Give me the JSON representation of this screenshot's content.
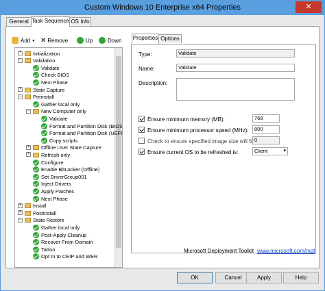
{
  "window": {
    "title": "Custom Windows 10 Enterprise x64 Properties",
    "close": "✕"
  },
  "tabs": [
    "General",
    "Task Sequence",
    "OS Info"
  ],
  "toolbar": {
    "add": "Add",
    "remove": "Remove",
    "up": "Up",
    "down": "Down"
  },
  "tree": [
    {
      "label": "Initialization",
      "icon": "folder",
      "level": 1,
      "exp": "+"
    },
    {
      "label": "Validation",
      "icon": "folder",
      "level": 1,
      "exp": "−"
    },
    {
      "label": "Validate",
      "icon": "check",
      "level": 2
    },
    {
      "label": "Check BIOS",
      "icon": "check",
      "level": 2
    },
    {
      "label": "Next Phase",
      "icon": "check",
      "level": 2
    },
    {
      "label": "State Capture",
      "icon": "folder",
      "level": 1,
      "exp": "+"
    },
    {
      "label": "Preinstall",
      "icon": "folder",
      "level": 1,
      "exp": "−"
    },
    {
      "label": "Gather local only",
      "icon": "check",
      "level": 2
    },
    {
      "label": "New Computer only",
      "icon": "folder",
      "level": 2,
      "exp": "−"
    },
    {
      "label": "Validate",
      "icon": "check",
      "level": 3
    },
    {
      "label": "Format and Partition Disk (BIOS)",
      "icon": "check",
      "level": 3
    },
    {
      "label": "Format and Partition Disk (UEFI)",
      "icon": "check",
      "level": 3
    },
    {
      "label": "Copy scripts",
      "icon": "check",
      "level": 3
    },
    {
      "label": "Offline User State Capture",
      "icon": "folder",
      "level": 2,
      "exp": "+"
    },
    {
      "label": "Refresh only",
      "icon": "folder",
      "level": 2,
      "exp": "+"
    },
    {
      "label": "Configure",
      "icon": "check",
      "level": 2
    },
    {
      "label": "Enable BitLocker (Offline)",
      "icon": "check",
      "level": 2
    },
    {
      "label": "Set DriverGroup001",
      "icon": "check",
      "level": 2
    },
    {
      "label": "Inject Drivers",
      "icon": "check",
      "level": 2
    },
    {
      "label": "Apply Patches",
      "icon": "check",
      "level": 2
    },
    {
      "label": "Next Phase",
      "icon": "check",
      "level": 2
    },
    {
      "label": "Install",
      "icon": "folder",
      "level": 1,
      "exp": "+"
    },
    {
      "label": "Postinstall",
      "icon": "folder",
      "level": 1,
      "exp": "+"
    },
    {
      "label": "State Restore",
      "icon": "folder",
      "level": 1,
      "exp": "−"
    },
    {
      "label": "Gather local only",
      "icon": "check",
      "level": 2
    },
    {
      "label": "Post-Apply Cleanup",
      "icon": "check",
      "level": 2
    },
    {
      "label": "Recover From Domain",
      "icon": "check",
      "level": 2
    },
    {
      "label": "Tattoo",
      "icon": "check",
      "level": 2
    },
    {
      "label": "Opt In to CEIP and WER",
      "icon": "check",
      "level": 2
    }
  ],
  "inner_tabs": [
    "Properties",
    "Options"
  ],
  "props": {
    "type_label": "Type:",
    "type_value": "Validate",
    "name_label": "Name:",
    "name_value": "Validate",
    "desc_label": "Description:",
    "mem_label": "Ensure minimum memory (MB):",
    "mem_value": "768",
    "cpu_label": "Ensure minimum processor speed (MHz):",
    "cpu_value": "800",
    "img_label": "Check to ensure specified image size will fit (MB):",
    "img_value": "0",
    "os_label": "Ensure current OS to be refreshed is:",
    "os_value": "Client"
  },
  "footer": {
    "toolkit": "Microsoft Deployment Toolkit",
    "link": "www.microsoft.com/mdt"
  },
  "buttons": {
    "ok": "OK",
    "cancel": "Cancel",
    "apply": "Apply",
    "help": "Help"
  }
}
